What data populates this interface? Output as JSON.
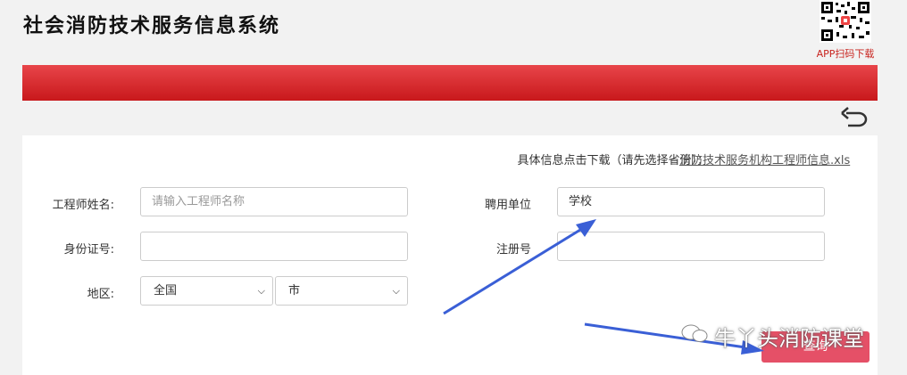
{
  "header": {
    "title": "社会消防技术服务信息系统",
    "qr_caption": "APP扫码下载"
  },
  "download": {
    "text": "具体信息点击下载（请先选择省份）：",
    "link_label": "消防技术服务机构工程师信息.xls"
  },
  "form": {
    "name_label": "工程师姓名:",
    "name_placeholder": "请输入工程师名称",
    "employer_label": "聘用单位",
    "employer_value": "学校",
    "id_label": "身份证号:",
    "reg_label": "注册号",
    "region_label": "地区:",
    "province_selected": "全国",
    "city_selected": "市"
  },
  "query_button": "查询",
  "watermark": "牛丫头消防课堂",
  "colors": {
    "brand_red": "#d01a1d",
    "button": "#e55067",
    "arrow": "#3a5fd6"
  }
}
